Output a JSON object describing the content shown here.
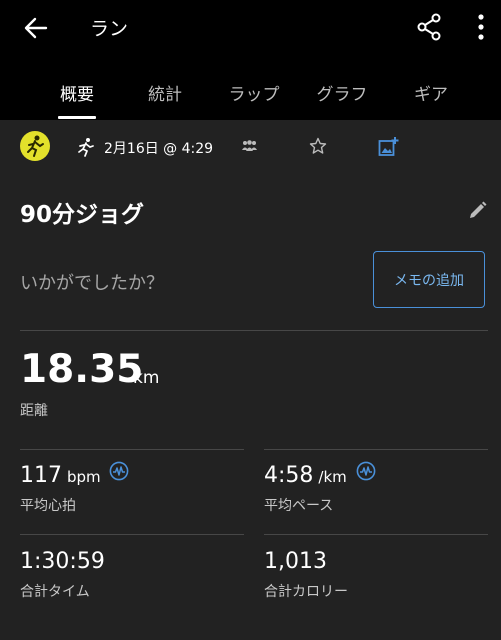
{
  "header": {
    "title": "ラン"
  },
  "tabs": [
    {
      "label": "概要",
      "active": true
    },
    {
      "label": "統計"
    },
    {
      "label": "ラップ"
    },
    {
      "label": "グラフ"
    },
    {
      "label": "ギア"
    }
  ],
  "activity": {
    "datetime": "2月16日 @ 4:29",
    "name": "90分ジョグ",
    "feeling_prompt": "いかがでしたか？",
    "memo_button": "メモの追加"
  },
  "distance": {
    "value": "18.35",
    "unit": "km",
    "label": "距離"
  },
  "stats": {
    "heart_rate": {
      "value": "117",
      "unit": "bpm",
      "label": "平均心拍"
    },
    "pace": {
      "value": "4:58",
      "unit": "/km",
      "label": "平均ペース"
    },
    "time": {
      "value": "1:30:59",
      "label": "合計タイム"
    },
    "calories": {
      "value": "1,013",
      "label": "合計カロリー"
    }
  },
  "colors": {
    "activity_icon": "#e3e12b",
    "accent": "#4a90d9",
    "panel": "#222222"
  }
}
